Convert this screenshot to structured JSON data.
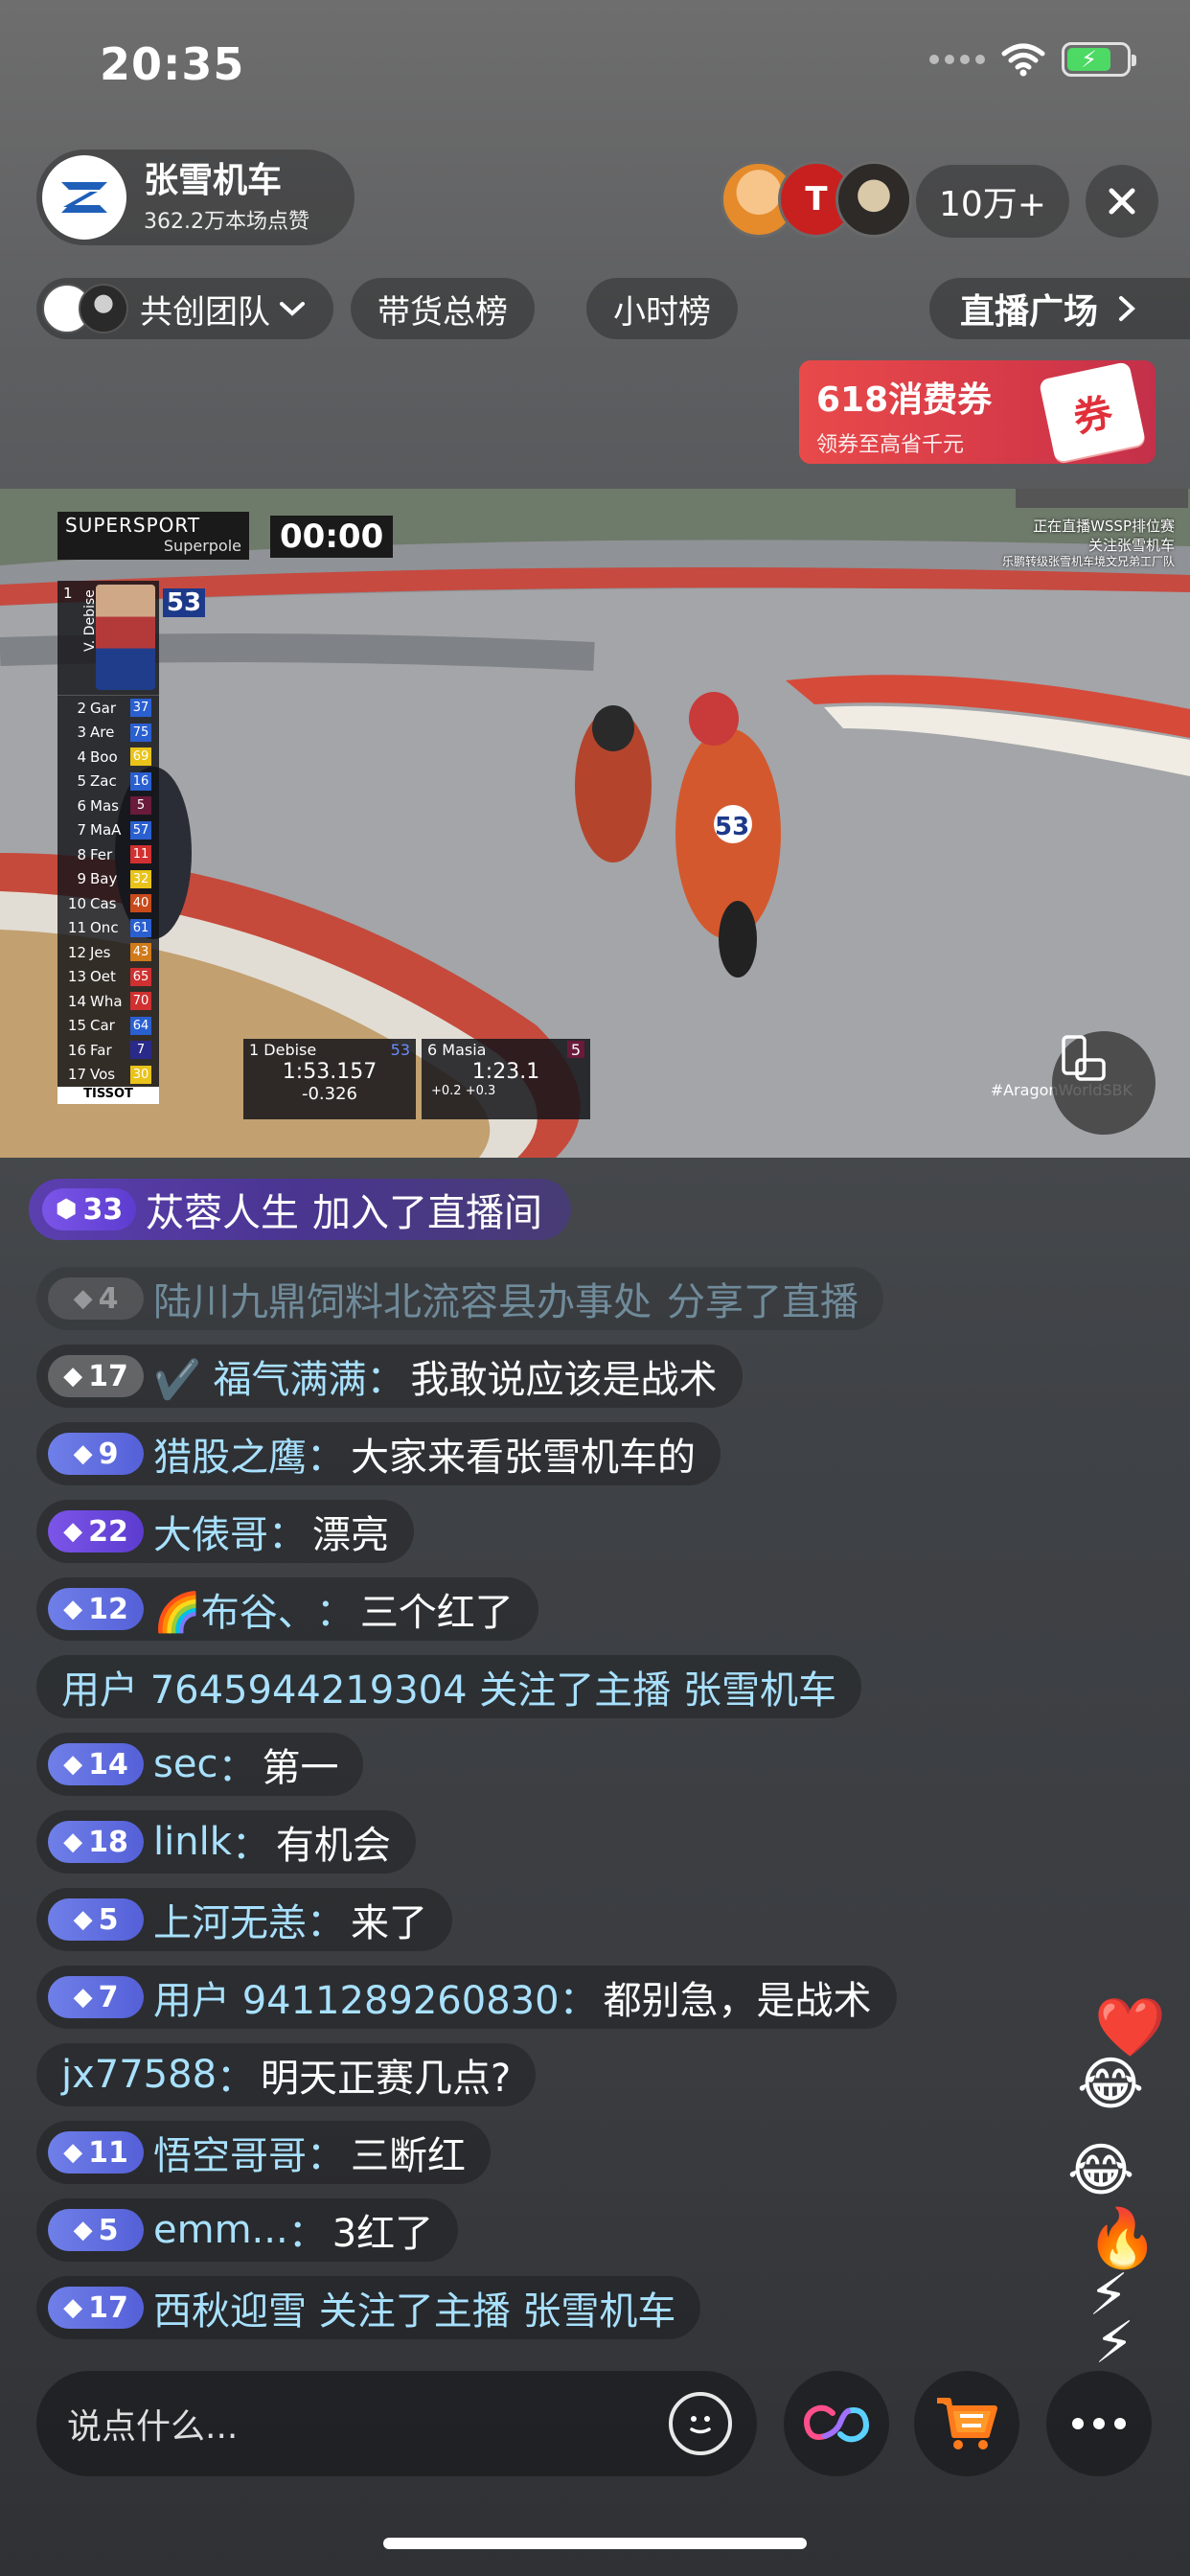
{
  "status_bar": {
    "time": "20:35"
  },
  "host": {
    "name": "张雪机车",
    "likes": "362.2万本场点赞"
  },
  "viewers": {
    "count": "10万+"
  },
  "chips": {
    "team": "共创团队",
    "sales_rank": "带货总榜",
    "hour_rank": "小时榜",
    "plaza": "直播广场"
  },
  "coupon": {
    "title": "618消费券",
    "subtitle": "领券至高省千元",
    "badge": "券"
  },
  "video_overlay": {
    "series": "SUPERSPORT",
    "session": "Superpole",
    "timer": "00:00",
    "leader": {
      "pos": "1",
      "name": "V. Debise",
      "number": "53"
    },
    "standings": [
      {
        "pos": "2",
        "name": "Gar",
        "no": "37",
        "color": "#2a5fd0"
      },
      {
        "pos": "3",
        "name": "Are",
        "no": "75",
        "color": "#2a5fd0"
      },
      {
        "pos": "4",
        "name": "Boo",
        "no": "69",
        "color": "#e9c31a"
      },
      {
        "pos": "5",
        "name": "Zac",
        "no": "16",
        "color": "#2a5fd0"
      },
      {
        "pos": "6",
        "name": "Mas",
        "no": "5",
        "color": "#6a1a3a"
      },
      {
        "pos": "7",
        "name": "MaA",
        "no": "57",
        "color": "#2a5fd0"
      },
      {
        "pos": "8",
        "name": "Fer",
        "no": "11",
        "color": "#d03030"
      },
      {
        "pos": "9",
        "name": "Bay",
        "no": "32",
        "color": "#e9c31a"
      },
      {
        "pos": "10",
        "name": "Cas",
        "no": "40",
        "color": "#c84a1a"
      },
      {
        "pos": "11",
        "name": "Onc",
        "no": "61",
        "color": "#2a5fd0"
      },
      {
        "pos": "12",
        "name": "Jes",
        "no": "43",
        "color": "#d07a1a"
      },
      {
        "pos": "13",
        "name": "Oet",
        "no": "65",
        "color": "#d03030"
      },
      {
        "pos": "14",
        "name": "Wha",
        "no": "70",
        "color": "#d03030"
      },
      {
        "pos": "15",
        "name": "Car",
        "no": "64",
        "color": "#2a5fd0"
      },
      {
        "pos": "16",
        "name": "Far",
        "no": "7",
        "color": "#2a2a8a"
      },
      {
        "pos": "17",
        "name": "Vos",
        "no": "30",
        "color": "#e9c31a"
      }
    ],
    "sponsor": "TISSOT",
    "timing_left": {
      "pos": "1",
      "name": "Debise",
      "no": "53",
      "lap": "1:53.157",
      "gap": "-0.326"
    },
    "timing_right": {
      "pos": "6",
      "name": "Masia",
      "no": "5",
      "lap": "1:23.1",
      "s1": "+0.2",
      "s2": "+0.3"
    },
    "broadcast_note": [
      "正在直播WSSP排位赛",
      "关注张雪机车",
      "乐鹏转级张雪机车境文兄弟工厂队"
    ],
    "hashtag": "#AragonWorldSBK",
    "rider_number": "53"
  },
  "join_banner": {
    "level": "33",
    "name": "苁蓉人生",
    "action": "加入了直播间"
  },
  "chat": [
    {
      "level": "4",
      "badge": "grey",
      "user": "陆川九鼎饲料北流容县办事处",
      "sep": "",
      "text": "分享了直播",
      "faded": true
    },
    {
      "level": "17",
      "badge": "grey",
      "user": "✔️ 福气满满",
      "sep": "：",
      "text": "我敢说应该是战术",
      "faded": false
    },
    {
      "level": "9",
      "badge": "blue",
      "user": "猎股之鹰",
      "sep": "：",
      "text": "大家来看张雪机车的",
      "faded": false
    },
    {
      "level": "22",
      "badge": "purple",
      "user": "大俵哥",
      "sep": "：",
      "text": "漂亮",
      "faded": false
    },
    {
      "level": "12",
      "badge": "blue",
      "user": "🌈布谷、",
      "sep": "：",
      "text": "三个红了",
      "faded": false
    },
    {
      "level": "",
      "badge": "none",
      "user": "用户 7645944219304 关注了主播 张雪机车",
      "sep": "",
      "text": "",
      "faded": false
    },
    {
      "level": "14",
      "badge": "blue",
      "user": "sec",
      "sep": "：",
      "text": "第一",
      "faded": false
    },
    {
      "level": "18",
      "badge": "blue",
      "user": "linlk",
      "sep": "：",
      "text": "有机会",
      "faded": false
    },
    {
      "level": "5",
      "badge": "blue",
      "user": "上河无恙",
      "sep": "：",
      "text": "来了",
      "faded": false
    },
    {
      "level": "7",
      "badge": "blue",
      "user": "用户 9411289260830",
      "sep": "：",
      "text": "都别急，是战术",
      "faded": false
    },
    {
      "level": "",
      "badge": "none",
      "user": "jx77588",
      "sep": "：",
      "text": "明天正赛几点?",
      "faded": false
    },
    {
      "level": "11",
      "badge": "blue",
      "user": "悟空哥哥",
      "sep": "：",
      "text": "三断红",
      "faded": false
    },
    {
      "level": "5",
      "badge": "blue",
      "user": "emm...",
      "sep": "：",
      "text": "3红了",
      "faded": false
    },
    {
      "level": "17",
      "badge": "blue",
      "user": "西秋迎雪 关注了主播 张雪机车",
      "sep": "",
      "text": "",
      "faded": false
    }
  ],
  "input": {
    "placeholder": "说点什么..."
  },
  "icons": {
    "emoji": "smiley-icon",
    "link": "link-icon",
    "cart": "cart-icon",
    "more": "more-icon",
    "close": "close-icon",
    "chevron": "chevron-right-icon"
  },
  "colors": {
    "username": "#a8e1ff",
    "badge_blue": "#6f7fe8",
    "badge_purple": "#7b55e8",
    "coupon": "#e84a4a"
  }
}
